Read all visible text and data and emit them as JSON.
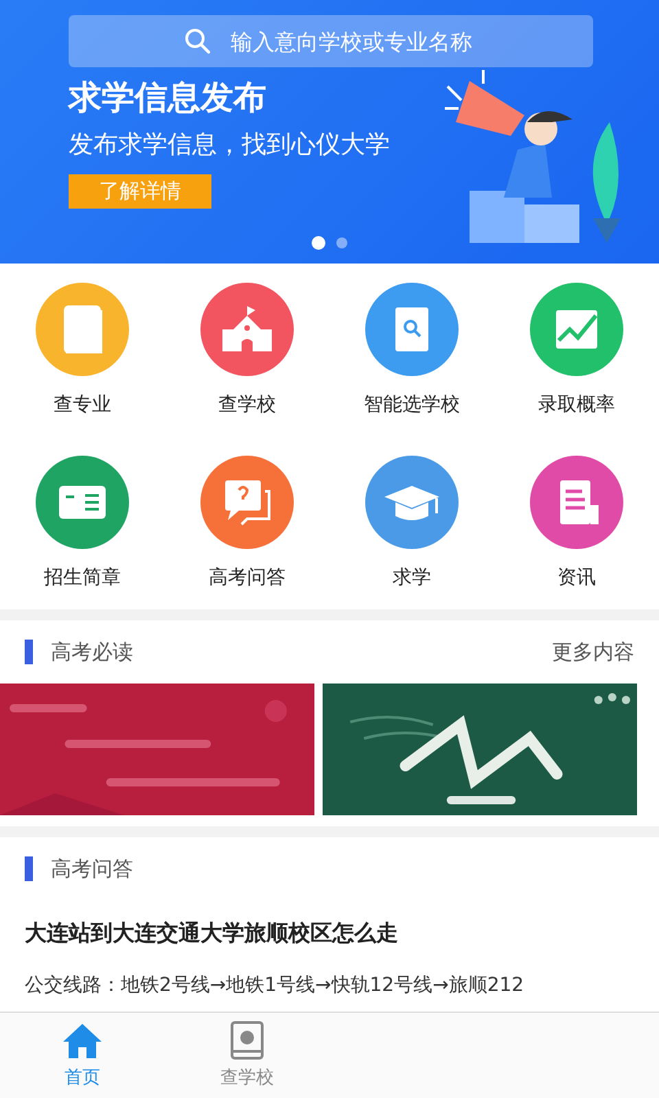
{
  "banner": {
    "search": {
      "placeholder": "输入意向学校或专业名称"
    },
    "title": "求学信息发布",
    "subtitle": "发布求学信息，找到心仪大学",
    "button": "了解详情",
    "dots": [
      {
        "selected": true
      },
      {
        "selected": false
      }
    ]
  },
  "shortcuts": [
    {
      "label": "查专业",
      "color": "#f7b42c"
    },
    {
      "label": "查学校",
      "color": "#f2555f"
    },
    {
      "label": "智能选学校",
      "color": "#3d9bf0"
    },
    {
      "label": "录取概率",
      "color": "#22c06a"
    },
    {
      "label": "招生简章",
      "color": "#1fa463"
    },
    {
      "label": "高考问答",
      "color": "#f6703a"
    },
    {
      "label": "求学",
      "color": "#4a9ae8"
    },
    {
      "label": "资讯",
      "color": "#e04ba8"
    }
  ],
  "must_read": {
    "title": "高考必读",
    "more": "更多内容"
  },
  "qa": {
    "title": "高考问答",
    "question": "大连站到大连交通大学旅顺校区怎么走",
    "answer": "公交线路：地铁2号线→地铁1号线→快轨12号线→旅顺212"
  },
  "tabs": [
    {
      "label": "首页",
      "selected": true
    },
    {
      "label": "查学校",
      "selected": false
    }
  ]
}
